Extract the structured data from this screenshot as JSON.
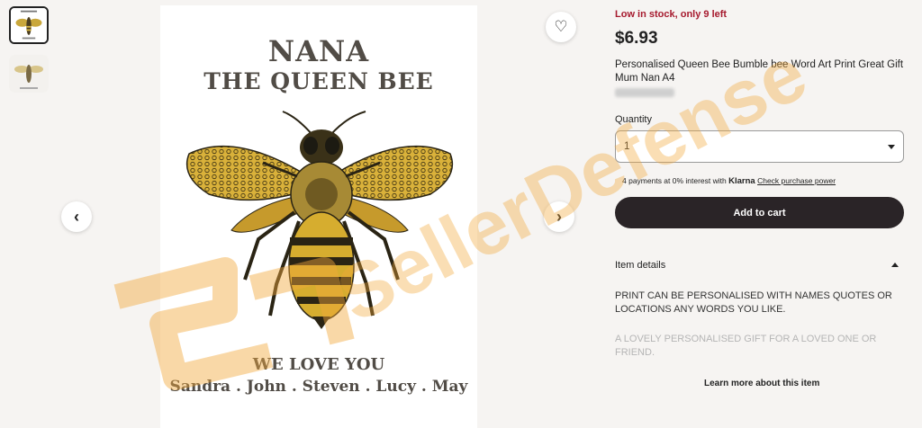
{
  "gallery": {
    "thumbnails": [
      {
        "alt": "bee print thumbnail"
      },
      {
        "alt": "bee print thumbnail alternate"
      }
    ],
    "poster": {
      "title_line1": "NANA",
      "title_line2": "THE QUEEN BEE",
      "footer_line1": "WE LOVE YOU",
      "footer_line2": "Sandra . John . Steven . Lucy . May"
    },
    "prev_icon": "chevron-left-icon",
    "next_icon": "chevron-right-icon",
    "favorite_icon": "heart-icon",
    "prev_symbol": "‹",
    "next_symbol": "›",
    "heart_symbol": "♡"
  },
  "product": {
    "stock_text": "Low in stock, only 9 left",
    "price": "$6.93",
    "title": "Personalised Queen Bee Bumble bee Word Art Print Great Gift Mum Nan A4",
    "quantity_label": "Quantity",
    "quantity_value": "1",
    "klarna_prefix": "4 payments at 0% interest with",
    "klarna_brand": "Klarna",
    "klarna_link": "Check purchase power",
    "add_to_cart": "Add to cart",
    "item_details_label": "Item details",
    "description_1": "PRINT CAN BE PERSONALISED WITH NAMES QUOTES OR LOCATIONS ANY WORDS YOU LIKE.",
    "description_2": "A LOVELY PERSONALISED GIFT FOR A LOVED ONE OR FRIEND.",
    "learn_more": "Learn more about this item"
  },
  "watermark": {
    "text": "SellerDefense",
    "color": "#f2a93b"
  },
  "colors": {
    "stock_red": "#a61a2e",
    "button_dark": "#2a2427",
    "page_bg": "#f6f4f2"
  }
}
